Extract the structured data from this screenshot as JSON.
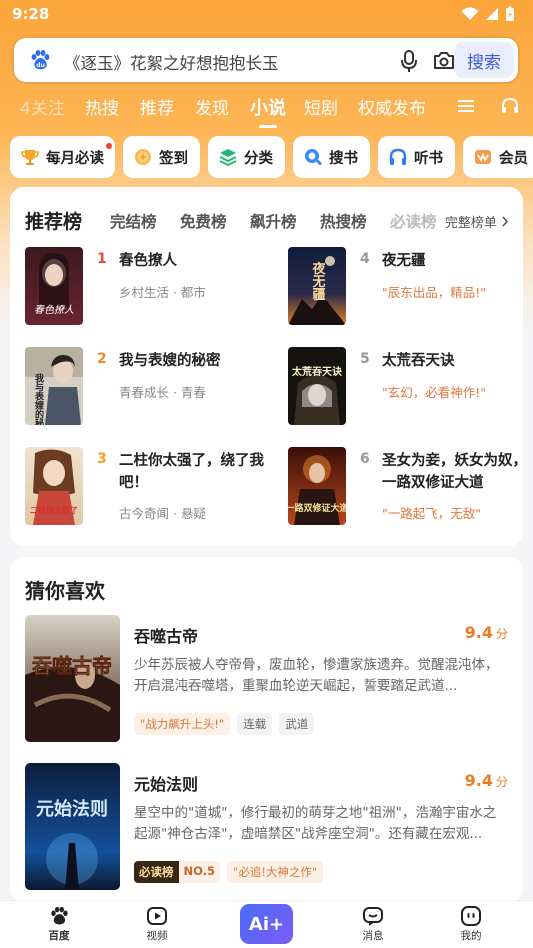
{
  "status": {
    "time": "9:28"
  },
  "search": {
    "placeholder": "《逐玉》花絮之好想抱抱长玉",
    "button": "搜索"
  },
  "tabs": [
    {
      "label": "关注"
    },
    {
      "label": "热搜"
    },
    {
      "label": "推荐"
    },
    {
      "label": "发现"
    },
    {
      "label": "小说"
    },
    {
      "label": "短剧"
    },
    {
      "label": "权威发布"
    }
  ],
  "tab_badge": "4",
  "quick": [
    {
      "label": "每月必读",
      "icon": "trophy-icon"
    },
    {
      "label": "签到",
      "icon": "coin-icon"
    },
    {
      "label": "分类",
      "icon": "layers-icon"
    },
    {
      "label": "搜书",
      "icon": "search-book-icon"
    },
    {
      "label": "听书",
      "icon": "headphones-icon"
    },
    {
      "label": "会员",
      "icon": "vip-icon"
    }
  ],
  "rank": {
    "tabs": [
      "推荐榜",
      "完结榜",
      "免费榜",
      "飙升榜",
      "热搜榜",
      "必读榜"
    ],
    "more": "完整榜单",
    "books": [
      {
        "num": "1",
        "title": "春色撩人",
        "sub": "乡村生活 · 都市",
        "cover_text": "春色撩人"
      },
      {
        "num": "2",
        "title": "我与表嫂的秘密",
        "sub": "青春成长 · 青春",
        "cover_text": "我与表嫂的秘密"
      },
      {
        "num": "3",
        "title": "二柱你太强了，绕了我吧！",
        "sub": "古今奇闻 · 悬疑",
        "cover_text": "二柱你太强了"
      },
      {
        "num": "4",
        "title": "夜无疆",
        "sub": "\"辰东出品，精品!\"",
        "cover_text": "夜无疆"
      },
      {
        "num": "5",
        "title": "太荒吞天诀",
        "sub": "\"玄幻，必看神作!\"",
        "cover_text": "太荒吞天诀"
      },
      {
        "num": "6",
        "title": "圣女为妾，妖女为奴，一路双修证大道",
        "sub": "\"一路起飞，无敌\"",
        "cover_text": "一路双修证大道"
      }
    ]
  },
  "guess": {
    "title": "猜你喜欢",
    "items": [
      {
        "title": "吞噬古帝",
        "score": "9.4",
        "unit": "分",
        "desc": "少年苏辰被人夺帝骨，废血轮，惨遭家族遗弃。觉醒混沌体，开启混沌吞噬塔，重聚血轮逆天崛起，誓要踏足武道...",
        "tags": [
          "\"战力飙升上头!\"",
          "连载",
          "武道"
        ],
        "cover_text": "吞噬古帝"
      },
      {
        "title": "元始法则",
        "score": "9.4",
        "unit": "分",
        "desc": "星空中的\"道城\"，修行最初的萌芽之地\"祖洲\"，浩瀚宇宙水之起源\"神仓古泽\"，虚暗禁区\"战斧座空洞\"。还有藏在宏观...",
        "rank_badge": {
          "left": "必读榜",
          "right": "NO.5"
        },
        "tags": [
          "\"必追!大神之作\""
        ],
        "cover_text": "元始法则"
      }
    ]
  },
  "nav": [
    {
      "label": "百度"
    },
    {
      "label": "视频"
    },
    {
      "label": "Ai+"
    },
    {
      "label": "消息"
    },
    {
      "label": "我的"
    }
  ]
}
